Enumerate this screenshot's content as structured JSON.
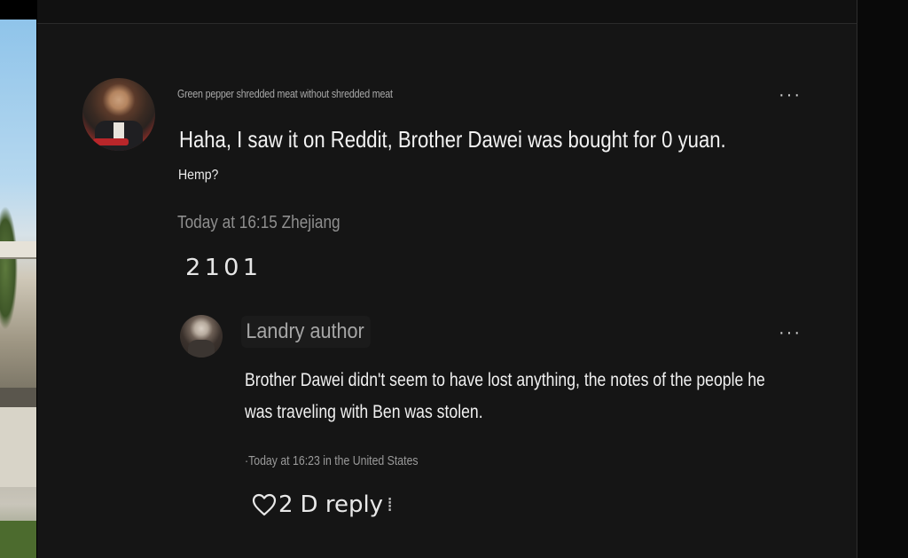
{
  "comment": {
    "username": "Green pepper shredded meat without shredded meat",
    "text": "Haha, I saw it on Reddit, Brother Dawei was bought for 0 yuan.",
    "subtext": "Hemp?",
    "meta": "Today at 16:15 Zhejiang",
    "likes": "2101",
    "more_icon": "···"
  },
  "reply": {
    "username": "Landry author",
    "text": "Brother Dawei didn't seem to have lost anything, the notes of the people he was traveling with Ben was stolen.",
    "meta": "·Today at 16:23 in the United States",
    "more_icon": "···",
    "likes": "2",
    "reply_label": "D reply"
  },
  "icons": {
    "heart": "heart-outline-icon",
    "more": "more-horizontal-icon"
  },
  "colors": {
    "panel_bg": "#151515",
    "text_primary": "#f2f2f2",
    "text_muted": "#8f8f8f"
  }
}
